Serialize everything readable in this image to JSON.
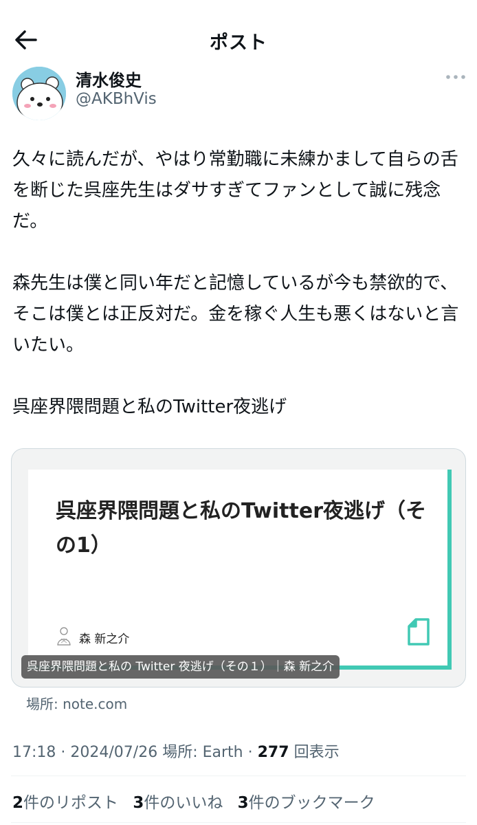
{
  "header": {
    "title": "ポスト",
    "back_icon": "arrow-left-icon"
  },
  "author": {
    "name": "清水俊史",
    "handle": "@AKBhVis",
    "avatar_icon": "bear-avatar",
    "more_icon": "more-dots-icon"
  },
  "post": {
    "paragraph1": "久々に読んだが、やはり常勤職に未練かまして自らの舌を断じた呉座先生はダサすぎてファンとして誠に残念だ。",
    "paragraph2": "森先生は僕と同い年だと記憶しているが今も禁欲的で、そこは僕とは正反対だ。金を稼ぐ人生も悪くはないと言いたい。",
    "paragraph3": "呉座界隈問題と私のTwitter夜逃げ"
  },
  "card": {
    "title": "呉座界隈問題と私のTwitter夜逃げ（その1）",
    "author": "森 新之介",
    "caption": "呉座界隈問題と私の Twitter 夜逃げ（その１）｜森 新之介",
    "source": "場所: note.com",
    "accent_color": "#41c9b4"
  },
  "meta": {
    "time": "17:18",
    "date": "2024/07/26",
    "location": "場所: Earth",
    "views_count": "277",
    "views_label": "回表示"
  },
  "stats": {
    "reposts_count": "2",
    "reposts_label": "件のリポスト",
    "likes_count": "3",
    "likes_label": "件のいいね",
    "bookmarks_count": "3",
    "bookmarks_label": "件のブックマーク"
  }
}
